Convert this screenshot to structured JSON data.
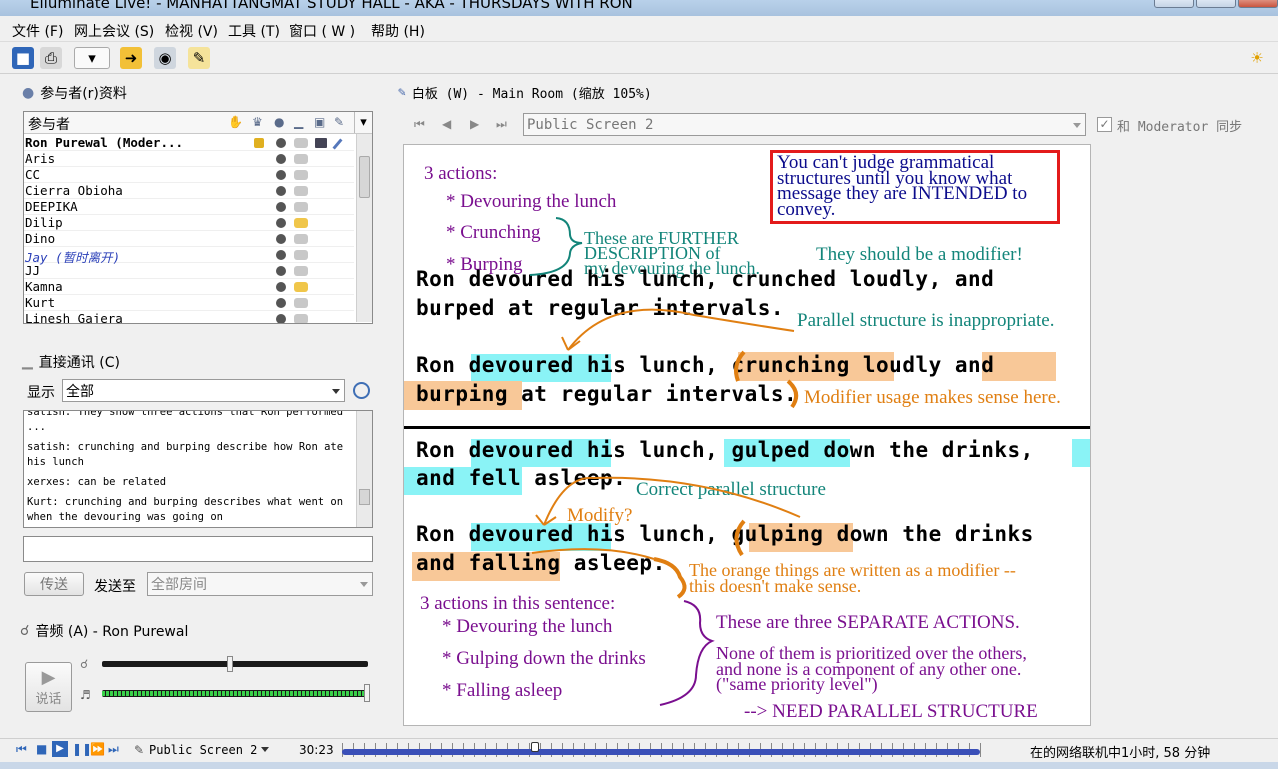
{
  "window": {
    "title": "Elluminate Live! - MANHATTANGMAT STUDY HALL - AKA - THURSDAYS WITH RON"
  },
  "menu": [
    "文件 (F)",
    "网上会议 (S)",
    "检视 (V)",
    "工具 (T)",
    "窗口 ( W )",
    "帮助 (H)"
  ],
  "toolbar": {
    "icons": [
      "save-icon",
      "print-icon",
      "layout-icon",
      "share-icon",
      "webcam-icon",
      "notes-icon",
      "lightbulb-icon"
    ]
  },
  "participants": {
    "title": "参与者(r)资料",
    "header": "参与者",
    "rows": [
      "Ron Purewal (Moder...",
      "Aris",
      "CC",
      "Cierra Obioha",
      "DEEPIKA",
      "Dilip",
      "Dino",
      "Jay (暂时离开)",
      "JJ",
      "Kamna",
      "Kurt",
      "Linesh Gajera"
    ]
  },
  "chat": {
    "title": "直接通讯 (C)",
    "show_label": "显示",
    "filter_value": "全部",
    "messages": [
      "satish: They show three actions that Ron performed ...",
      "satish: crunching and burping describe how Ron ate his lunch",
      "xerxes: can be related",
      "Kurt: crunching and burping describes what went on when the devouring was going on"
    ],
    "input_value": "",
    "send_button": "传送",
    "send_to_label": "发送至",
    "send_to_value": "全部房间"
  },
  "audio": {
    "title": "音频 (A) - Ron Purewal",
    "talk_button": "说话",
    "mic_level": 0.48,
    "speaker_level": 1.0
  },
  "whiteboard": {
    "title": "白板 (W) - Main Room (缩放 105%)",
    "screen_value": "Public Screen 2",
    "sync_label": "和 Moderator 同步",
    "sync_checked": true,
    "content": {
      "a1_title": "3 actions:",
      "a1_items": [
        "* Devouring the lunch",
        "* Crunching",
        "* Burping"
      ],
      "further": [
        "These are FURTHER",
        "DESCRIPTION of",
        "my devouring the lunch."
      ],
      "red_box": [
        "You can't judge grammatical",
        "structures until you know what",
        "message they are INTENDED to",
        "convey."
      ],
      "modifier_should": "They should be a modifier!",
      "s1": [
        "Ron devoured his lunch, crunched loudly, and",
        "burped at regular intervals."
      ],
      "parallel_inapprop": "Parallel structure is inappropriate.",
      "s2_a": [
        "Ron ",
        "devoured",
        " his lunch, ",
        "crunching",
        " loudly ",
        "and"
      ],
      "s2_b": [
        "burping",
        " at regular intervals."
      ],
      "modifier_usage": "Modifier usage makes sense here.",
      "s3_a": [
        "Ron ",
        "devoured",
        " his lunch",
        ", gulped",
        " down the drinks",
        ","
      ],
      "s3_b": [
        "and fell",
        " asleep."
      ],
      "correct_parallel": "Correct parallel structure",
      "modify": "Modify?",
      "s4_a": [
        "Ron ",
        "devoured",
        " his lunch, ",
        "gulping",
        " down the drinks"
      ],
      "s4_b": [
        "and falling",
        " asleep."
      ],
      "orange_note": [
        "The orange things are written as a modifier --",
        "this doesn't make sense."
      ],
      "a2_title": "3 actions in this sentence:",
      "a2_items": [
        "* Devouring the lunch",
        "* Gulping down the drinks",
        "* Falling asleep"
      ],
      "separate": "These are three SEPARATE ACTIONS.",
      "none_prior": [
        "None of them is prioritized over the others,",
        "and none is a component of any other one.",
        "(\"same priority level\")"
      ],
      "need_parallel": "--> NEED PARALLEL STRUCTURE"
    }
  },
  "player": {
    "screen_label": "Public Screen 2",
    "time": "30:23",
    "progress": 0.3,
    "status_text": "在的网络联机中1小时, 58 分钟"
  },
  "colors": {
    "accent_red": "#e31b1b",
    "purple": "#7a0f8f",
    "teal": "#13857a",
    "orange": "#e07f12",
    "cyan_highlight": "#8af3f6",
    "orange_highlight": "#f8c898"
  }
}
